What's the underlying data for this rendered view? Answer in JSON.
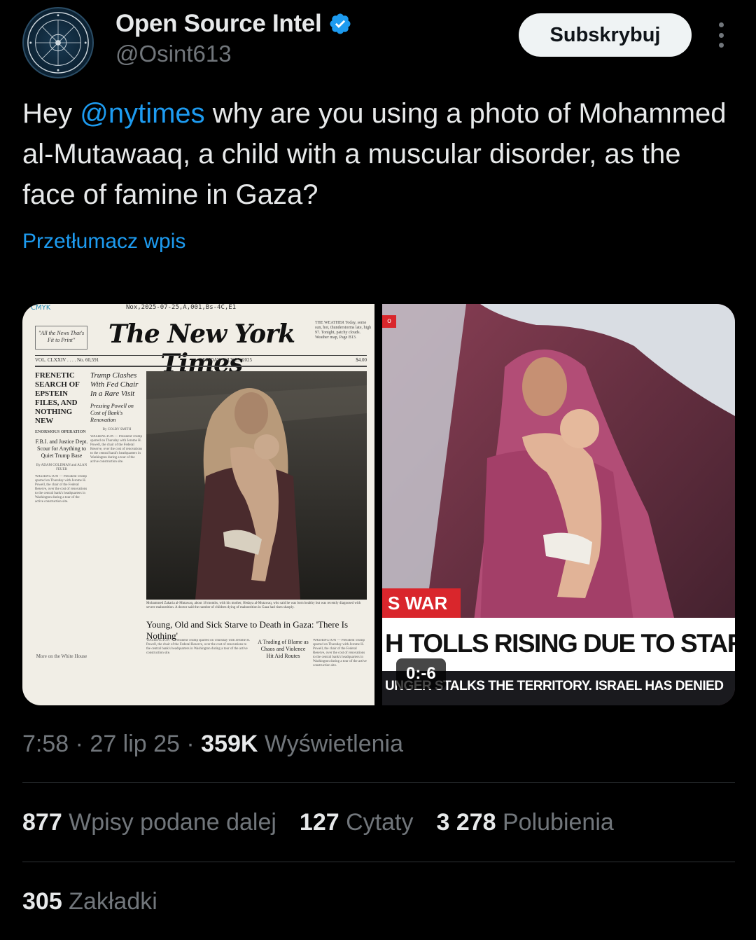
{
  "account": {
    "display_name": "Open Source Intel",
    "handle": "@Osint613",
    "verified_icon": "verified-badge-icon",
    "avatar_icon": "osint-seal-logo",
    "avatar_text": "OPEN SOURCE INTEL · OSINT613"
  },
  "header": {
    "subscribe_label": "Subskrybuj",
    "more_icon": "more-vertical-icon"
  },
  "tweet": {
    "text_before": "Hey ",
    "mention": "@nytimes",
    "text_after": " why are you using a photo of Mohammed al-Mutawaaq, a child with a muscular disorder, as the face of famine in Gaza?",
    "translate_label": "Przetłumacz wpis"
  },
  "media": {
    "newspaper": {
      "cmyk": "CMYK",
      "code": "Nox,2025-07-25,A,001,Bs-4C,E1",
      "motto": "\"All the News That's Fit to Print\"",
      "masthead": "The New York Times",
      "weather": "THE WEATHER Today, some sun, hot, thunderstorms late, high 97. Tonight, patchy clouds. Weather map, Page B13.",
      "vol": "VOL. CLXXIV . . . . No. 60,591",
      "date": "FRIDAY, JULY 25, 2025",
      "price": "$4.00",
      "left_headline": "FRENETIC SEARCH OF EPSTEIN FILES, AND NOTHING NEW",
      "left_kicker": "ENORMOUS OPERATION",
      "left_sub": "F.B.I. and Justice Dept. Scour for Anything to Quiet Trump Base",
      "left_byline": "By ADAM GOLDMAN and ALAN FEUER",
      "mid_headline": "Trump Clashes With Fed Chair In a Rare Visit",
      "mid_sub": "Pressing Powell on Cost of Bank's Renovation",
      "mid_byline": "By COLBY SMITH",
      "more_label": "More on the White House",
      "photo_caption": "Mohammed Zakaria al-Mutawaq, about 18 months, with his mother, Hedaya al-Mutawaq, who said he was born healthy but was recently diagnosed with severe malnutrition. A doctor said the number of children dying of malnutrition in Gaza had risen sharply.",
      "main_headline": "Young, Old and Sick Starve to Death in Gaza: 'There Is Nothing'",
      "side_headline": "A Trading of Blame as Chaos and Violence Hit Aid Routes",
      "body_filler": "WASHINGTON — President Trump sparred on Thursday with Jerome H. Powell, the chair of the Federal Reserve, over the cost of renovations to the central bank's headquarters in Washington during a tour of the active construction site."
    },
    "broadcast": {
      "corner_label": "o",
      "war_label": "S WAR",
      "headline": "H TOLLS RISING DUE TO STARVA",
      "ticker": "UNGER STALKS THE TERRITORY. ISRAEL HAS DENIED",
      "timer": "0:-6"
    }
  },
  "meta": {
    "time": "7:58",
    "sep1": " · ",
    "date": "27 lip 25",
    "sep2": " · ",
    "views_count": "359K",
    "views_label": " Wyświetlenia"
  },
  "stats": {
    "reposts_count": "877",
    "reposts_label": " Wpisy podane dalej",
    "quotes_count": "127",
    "quotes_label": " Cytaty",
    "likes_count": "3 278",
    "likes_label": " Polubienia",
    "bookmarks_count": "305",
    "bookmarks_label": " Zakładki"
  },
  "colors": {
    "background": "#000000",
    "text_primary": "#e7e9ea",
    "text_secondary": "#71767b",
    "link": "#1d9bf0",
    "divider": "#2f3336"
  }
}
